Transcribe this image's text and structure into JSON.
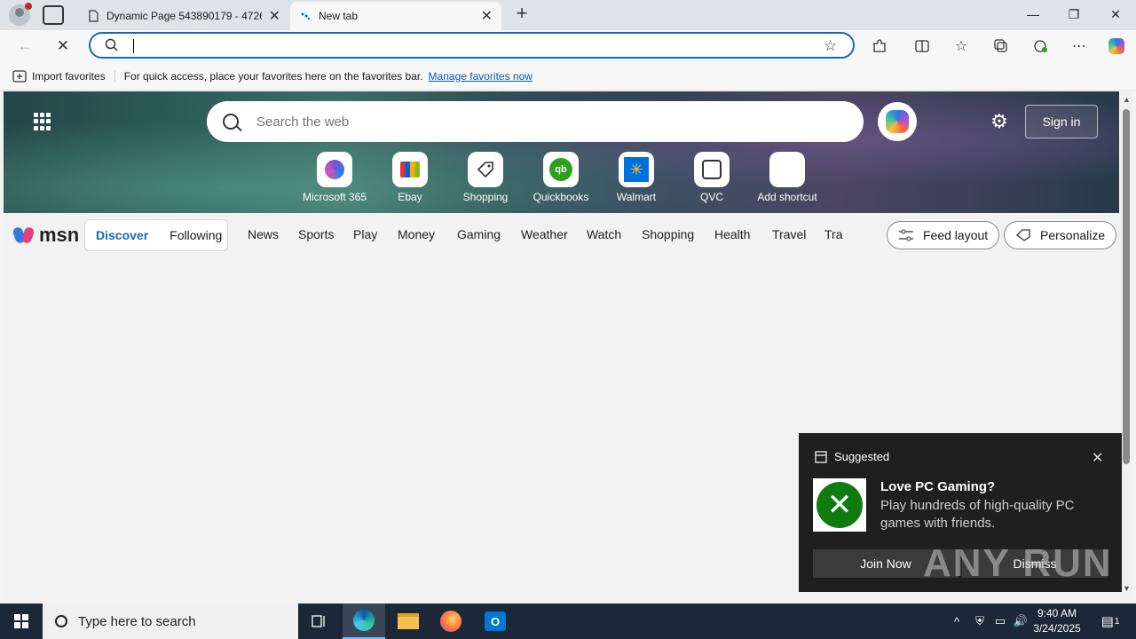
{
  "browser": {
    "tabs": [
      {
        "label": "Dynamic Page 543890179 - 4726(",
        "active": false
      },
      {
        "label": "New tab",
        "active": true
      }
    ],
    "address": {
      "value": "",
      "placeholder": ""
    }
  },
  "favorites_bar": {
    "import_label": "Import favorites",
    "message": "For quick access, place your favorites here on the favorites bar.",
    "manage_link": "Manage favorites now"
  },
  "newtab": {
    "search_placeholder": "Search the web",
    "signin_label": "Sign in",
    "shortcuts": [
      {
        "label": "Microsoft 365",
        "icon": "m365-icon",
        "color": "#7a4fd6"
      },
      {
        "label": "Ebay",
        "icon": "ebay-bag-icon",
        "color": "#e53238"
      },
      {
        "label": "Shopping",
        "icon": "tag-icon",
        "color": "#333333"
      },
      {
        "label": "Quickbooks",
        "icon": "quickbooks-icon",
        "color": "#2ca01c"
      },
      {
        "label": "Walmart",
        "icon": "walmart-icon",
        "color": "#0071dc"
      },
      {
        "label": "QVC",
        "icon": "qvc-icon",
        "color": "#333333"
      },
      {
        "label": "Add shortcut",
        "icon": "plus-icon",
        "color": "#333333"
      }
    ]
  },
  "msn": {
    "logo_text": "msn",
    "segments": [
      "Discover",
      "Following"
    ],
    "categories": [
      "News",
      "Sports",
      "Play",
      "Money",
      "Gaming",
      "Weather",
      "Watch",
      "Shopping",
      "Health",
      "Travel",
      "Tra"
    ],
    "feed_layout_label": "Feed layout",
    "personalize_label": "Personalize"
  },
  "popup": {
    "header": "Suggested",
    "title": "Love PC Gaming?",
    "body": "Play hundreds of high-quality PC games with friends.",
    "join_label": "Join Now",
    "dismiss_label": "Dismiss",
    "xbox_color": "#107c10"
  },
  "watermark": "ANY RUN",
  "taskbar": {
    "search_placeholder": "Type here to search",
    "time": "9:40 AM",
    "date": "3/24/2025",
    "notification_count": "1"
  }
}
